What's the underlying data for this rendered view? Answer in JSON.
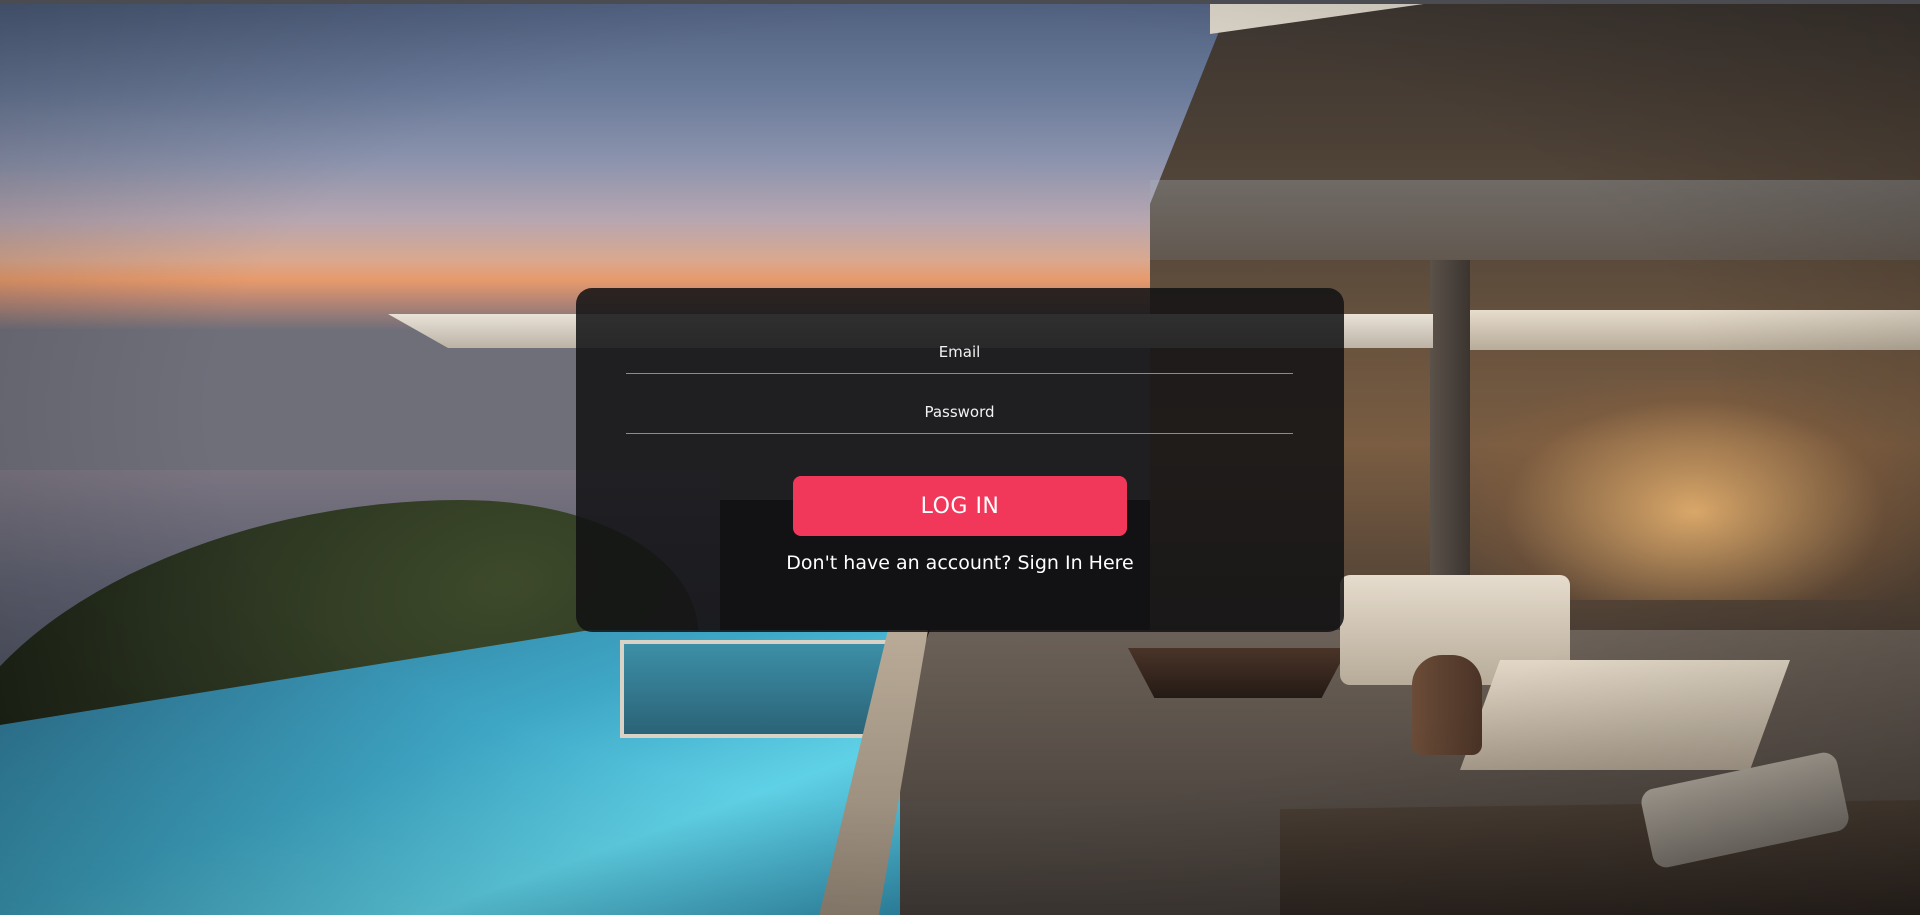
{
  "login": {
    "email_placeholder": "Email",
    "password_placeholder": "Password",
    "login_button": "LOG IN",
    "signup_link": "Don't have an account? Sign In Here"
  },
  "colors": {
    "accent": "#f2385a",
    "card_background": "#121214"
  }
}
